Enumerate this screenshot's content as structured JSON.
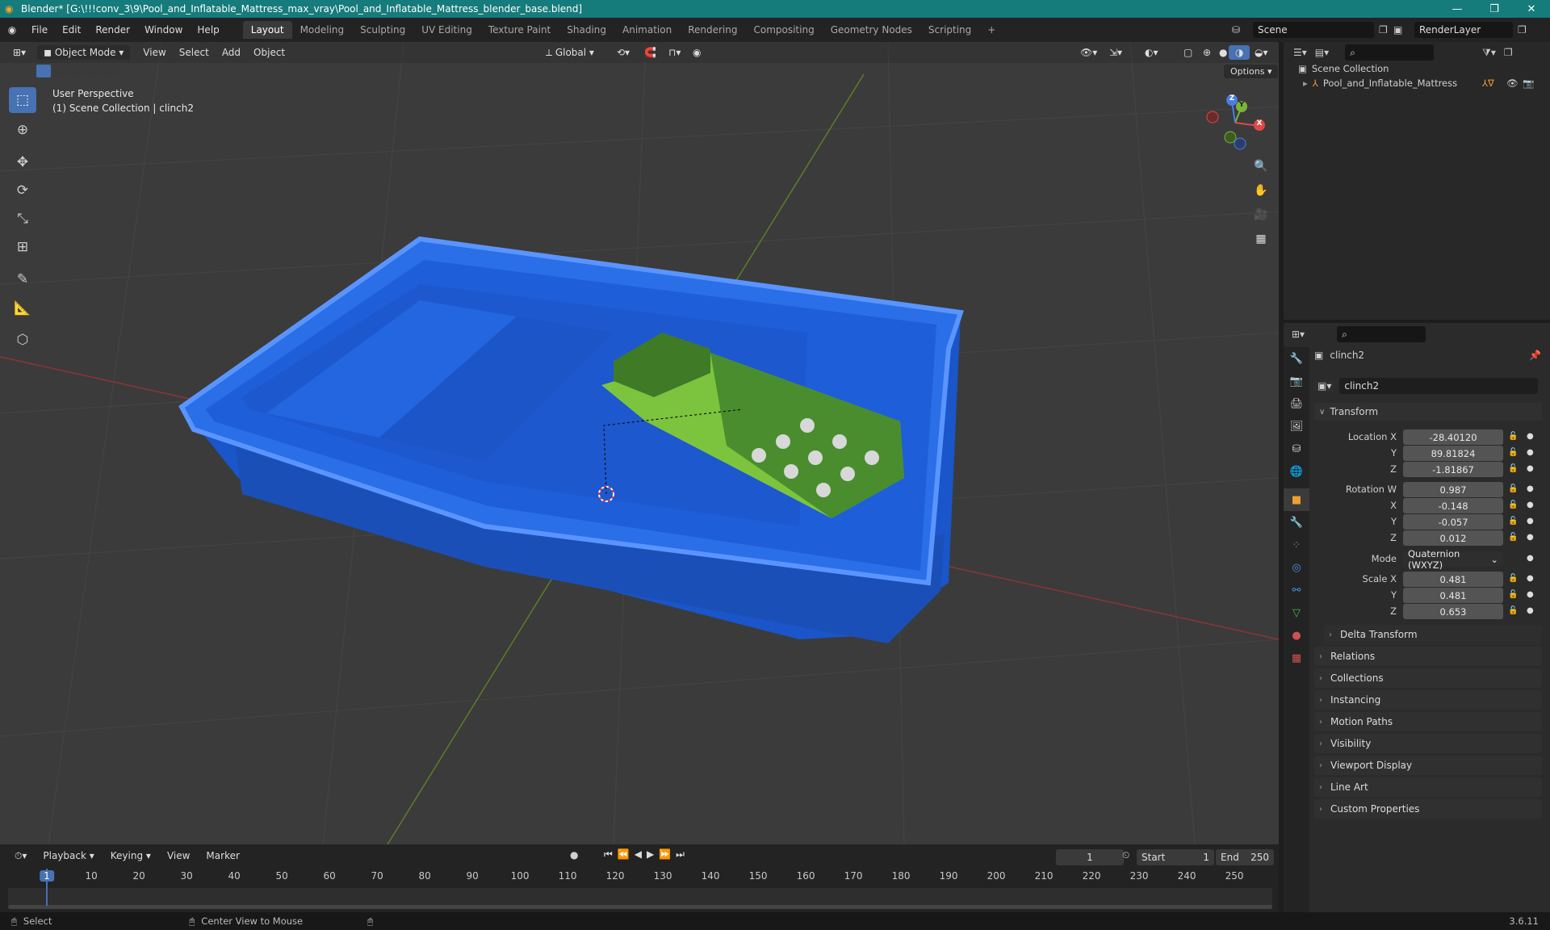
{
  "window": {
    "title": "Blender* [G:\\!!!conv_3\\9\\Pool_and_Inflatable_Mattress_max_vray\\Pool_and_Inflatable_Mattress_blender_base.blend]",
    "minimize": "—",
    "maximize": "❐",
    "close": "✕"
  },
  "menus": [
    "File",
    "Edit",
    "Render",
    "Window",
    "Help"
  ],
  "workspaces": [
    "Layout",
    "Modeling",
    "Sculpting",
    "UV Editing",
    "Texture Paint",
    "Shading",
    "Animation",
    "Rendering",
    "Compositing",
    "Geometry Nodes",
    "Scripting",
    "+"
  ],
  "scene": {
    "label": "Scene",
    "render_layer": "RenderLayer"
  },
  "viewport": {
    "mode": "Object Mode",
    "menus": [
      "View",
      "Select",
      "Add",
      "Object"
    ],
    "orientation": "Global",
    "options": "Options",
    "perspective": "User Perspective",
    "collection_info": "(1) Scene Collection | clinch2"
  },
  "gizmo": {
    "x": "X",
    "y": "Y",
    "z": "Z"
  },
  "outliner": {
    "root": "Scene Collection",
    "items": [
      {
        "name": "Pool_and_Inflatable_Mattress"
      }
    ]
  },
  "properties": {
    "object_name": "clinch2",
    "data_name": "clinch2",
    "transform_title": "Transform",
    "location_label": "Location X",
    "location": {
      "x": "-28.40120",
      "y": "89.81824",
      "z": "-1.81867"
    },
    "rotation_label": "Rotation W",
    "rotation": {
      "w": "0.987",
      "x": "-0.148",
      "y": "-0.057",
      "z": "0.012"
    },
    "mode_label": "Mode",
    "mode_value": "Quaternion (WXYZ)",
    "scale_label": "Scale X",
    "scale": {
      "x": "0.481",
      "y": "0.481",
      "z": "0.653"
    },
    "axis_labels": {
      "y": "Y",
      "z": "Z",
      "x": "X"
    },
    "delta": "Delta Transform",
    "panels": [
      "Relations",
      "Collections",
      "Instancing",
      "Motion Paths",
      "Visibility",
      "Viewport Display",
      "Line Art",
      "Custom Properties"
    ]
  },
  "timeline": {
    "menus": [
      "Playback",
      "Keying",
      "View",
      "Marker"
    ],
    "current_frame": "1",
    "start_label": "Start",
    "start": "1",
    "end_label": "End",
    "end": "250",
    "ticks": [
      "1",
      "10",
      "20",
      "30",
      "40",
      "50",
      "60",
      "70",
      "80",
      "90",
      "100",
      "110",
      "120",
      "130",
      "140",
      "150",
      "160",
      "170",
      "180",
      "190",
      "200",
      "210",
      "220",
      "230",
      "240",
      "250"
    ]
  },
  "status": {
    "select": "Select",
    "center": "Center View to Mouse",
    "version": "3.6.11"
  },
  "colors": {
    "accent": "#4772b3",
    "titlebar": "#167b7b",
    "pool": "#1f5fd6",
    "mattress": "#8fd44a"
  }
}
